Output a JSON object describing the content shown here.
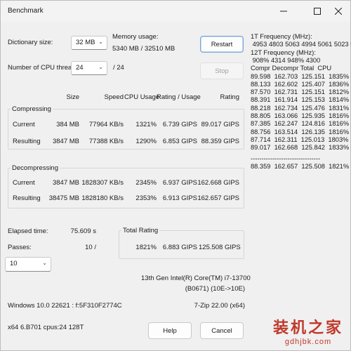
{
  "window": {
    "title": "Benchmark"
  },
  "icons": {
    "minimize": "minimize-icon",
    "maximize": "maximize-icon",
    "close": "close-icon"
  },
  "settings": {
    "dict_label": "Dictionary size:",
    "dict_value": "32 MB",
    "threads_label": "Number of CPU threads:",
    "threads_value": "24",
    "threads_max": "/ 24",
    "memory_label": "Memory usage:",
    "memory_value": "5340 MB / 32510 MB"
  },
  "buttons": {
    "restart": "Restart",
    "stop": "Stop",
    "help": "Help",
    "cancel": "Cancel"
  },
  "columns": {
    "size": "Size",
    "speed": "Speed",
    "cpu": "CPU Usage",
    "rating_usage": "Rating / Usage",
    "rating": "Rating"
  },
  "compressing": {
    "label": "Compressing",
    "current": {
      "label": "Current",
      "size": "384 MB",
      "speed": "77964 KB/s",
      "cpu": "1321%",
      "rating_usage": "6.739 GIPS",
      "rating": "89.017 GIPS"
    },
    "resulting": {
      "label": "Resulting",
      "size": "3847 MB",
      "speed": "77388 KB/s",
      "cpu": "1290%",
      "rating_usage": "6.853 GIPS",
      "rating": "88.359 GIPS"
    }
  },
  "decompressing": {
    "label": "Decompressing",
    "current": {
      "label": "Current",
      "size": "3847 MB",
      "speed": "1828307 KB/s",
      "cpu": "2345%",
      "rating_usage": "6.937 GIPS",
      "rating": "162.668 GIPS"
    },
    "resulting": {
      "label": "Resulting",
      "size": "38475 MB",
      "speed": "1828180 KB/s",
      "cpu": "2353%",
      "rating_usage": "6.913 GIPS",
      "rating": "162.657 GIPS"
    }
  },
  "elapsed": {
    "label": "Elapsed time:",
    "value": "75.609 s"
  },
  "passes": {
    "label": "Passes:",
    "value": "10 /",
    "select": "10"
  },
  "total": {
    "label": "Total Rating",
    "cpu": "1821%",
    "rating_usage": "6.883 GIPS",
    "rating": "125.508 GIPS"
  },
  "cpu_info": {
    "line1": "13th Gen Intel(R) Core(TM) i7-13700",
    "line2": "(B0671) (10E->10E)"
  },
  "os": {
    "line1": "Windows 10.0 22621 : f:5F310F2774C",
    "line2": "x64 6.B701 cpus:24 128T"
  },
  "version": "7-Zip 22.00 (x64)",
  "right_panel": {
    "lines": [
      "1T Frequency (MHz):",
      " 4953 4803 5063 4994 5061 5023 5044",
      "12T Frequency (MHz):",
      " 908% 4314 948% 4300",
      "Compr Decompr Total  CPU",
      "89.598  162.703  125.151  1835%",
      "88.133  162.602  125.407  1836%",
      "87.570  162.731  125.151  1812%",
      "88.391  161.914  125.153  1814%",
      "88.218  162.734  125.476  1831%",
      "88.805  163.066  125.935  1816%",
      "87.385  162.247  124.816  1816%",
      "88.756  163.514  126.135  1816%",
      "87.714  162.311  125.013  1803%",
      "89.017  162.668  125.842  1833%",
      "--------------------------------",
      "88.359  162.657  125.508  1821%"
    ]
  },
  "watermark": {
    "text": "装机之家",
    "url": "gdhjbk.com"
  }
}
